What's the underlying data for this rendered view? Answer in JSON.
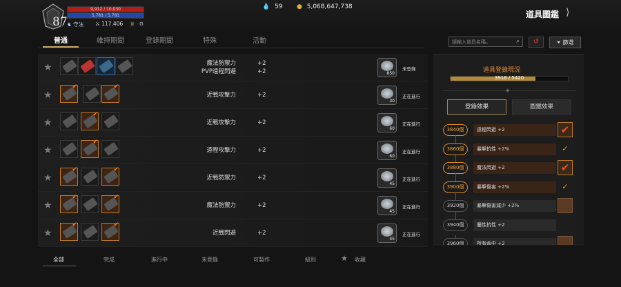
{
  "player": {
    "level": "87",
    "hp": "9,912 / 10,030",
    "mp": "5,781 / 5,781",
    "guild_label": "守法",
    "combat_power": "117,406"
  },
  "currency": {
    "gems": "59",
    "gold": "5,068,647,738"
  },
  "page": {
    "title": "道具圖鑑",
    "back_icon": "chevron-right-icon"
  },
  "tabs": [
    "普通",
    "維持期間",
    "登錄期間",
    "特殊",
    "活動"
  ],
  "search": {
    "placeholder": "請輸入道具名稱。",
    "filter_label": "篩選"
  },
  "rows": [
    {
      "stats": [
        "魔法防禦力",
        "PVP遠程閃避"
      ],
      "values": [
        "+2",
        "+2"
      ],
      "count": "850",
      "status": "未登錄"
    },
    {
      "stats": [
        "近戰攻擊力"
      ],
      "values": [
        "+2"
      ],
      "count": "30",
      "status": "正在進行"
    },
    {
      "stats": [
        "近戰攻擊力"
      ],
      "values": [
        "+2"
      ],
      "count": "60",
      "status": "正在進行"
    },
    {
      "stats": [
        "遠程攻擊力"
      ],
      "values": [
        "+2"
      ],
      "count": "60",
      "status": "正在進行"
    },
    {
      "stats": [
        "近戰防禦力"
      ],
      "values": [
        "+2"
      ],
      "count": "45",
      "status": "正在進行"
    },
    {
      "stats": [
        "魔法防禦力"
      ],
      "values": [
        "+2"
      ],
      "count": "45",
      "status": "正在進行"
    },
    {
      "stats": [
        "近戰閃避"
      ],
      "values": [
        "+2"
      ],
      "count": "45",
      "status": "正在進行"
    }
  ],
  "panel": {
    "title": "道具登錄現況",
    "progress_text": "3918 / 5420",
    "progress_fraction": 0.7229,
    "btn_register": "登錄效果",
    "btn_collection": "圖鑑效果",
    "milestones": [
      {
        "count": "3840個",
        "effect": "遠程閃避 +2",
        "done": true,
        "badge": "check"
      },
      {
        "count": "3860個",
        "effect": "暴擊抗性 +2%",
        "done": true,
        "badge": "tick"
      },
      {
        "count": "3880個",
        "effect": "魔法閃避 +2",
        "done": true,
        "badge": "check"
      },
      {
        "count": "3900個",
        "effect": "暴擊傷害 +2%",
        "done": true,
        "badge": "tick"
      },
      {
        "count": "3920個",
        "effect": "暴擊傷害減少 +2%",
        "done": false,
        "badge": "box"
      },
      {
        "count": "3940個",
        "effect": "屬性抗性 +2",
        "done": false,
        "badge": "none"
      },
      {
        "count": "3960個",
        "effect": "所有命中 +2",
        "done": false,
        "badge": "box"
      }
    ]
  },
  "bottom_tabs": [
    "全部",
    "完成",
    "進行中",
    "未登錄",
    "可製作",
    "級別",
    "收藏"
  ],
  "colors": {
    "accent": "#e08a3a",
    "hp": "#b51b1b",
    "mp": "#2546a8",
    "done_badge": "#ff4a2a"
  }
}
